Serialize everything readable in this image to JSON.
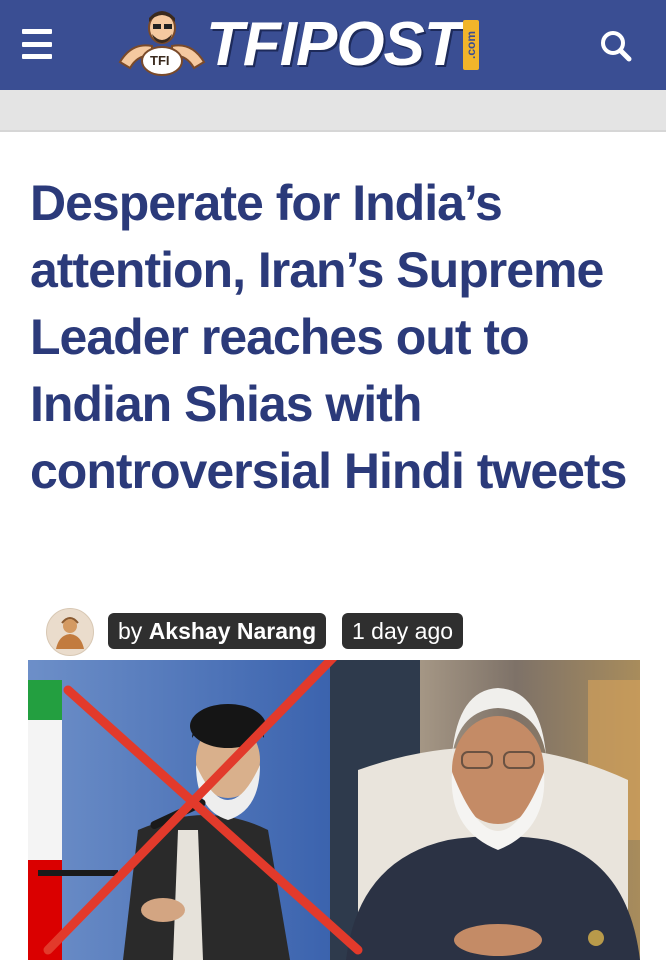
{
  "header": {
    "menu_icon": "hamburger-menu-icon",
    "logo_text": "TFIPOST",
    "logo_suffix": ".com",
    "mascot_badge": "TFI",
    "search_icon": "search-icon",
    "background_color": "#3a4e93"
  },
  "article": {
    "headline": "Desperate for India’s attention, Iran’s Supreme Leader reaches out to Indian Shias with controversial Hindi tweets",
    "author_prefix": "by",
    "author_name": "Akshay Narang",
    "time_ago": "1 day ago",
    "headline_color": "#2b3a7a"
  },
  "image": {
    "overlay_mark": "red-cross",
    "overlay_color": "#e23a2b"
  }
}
